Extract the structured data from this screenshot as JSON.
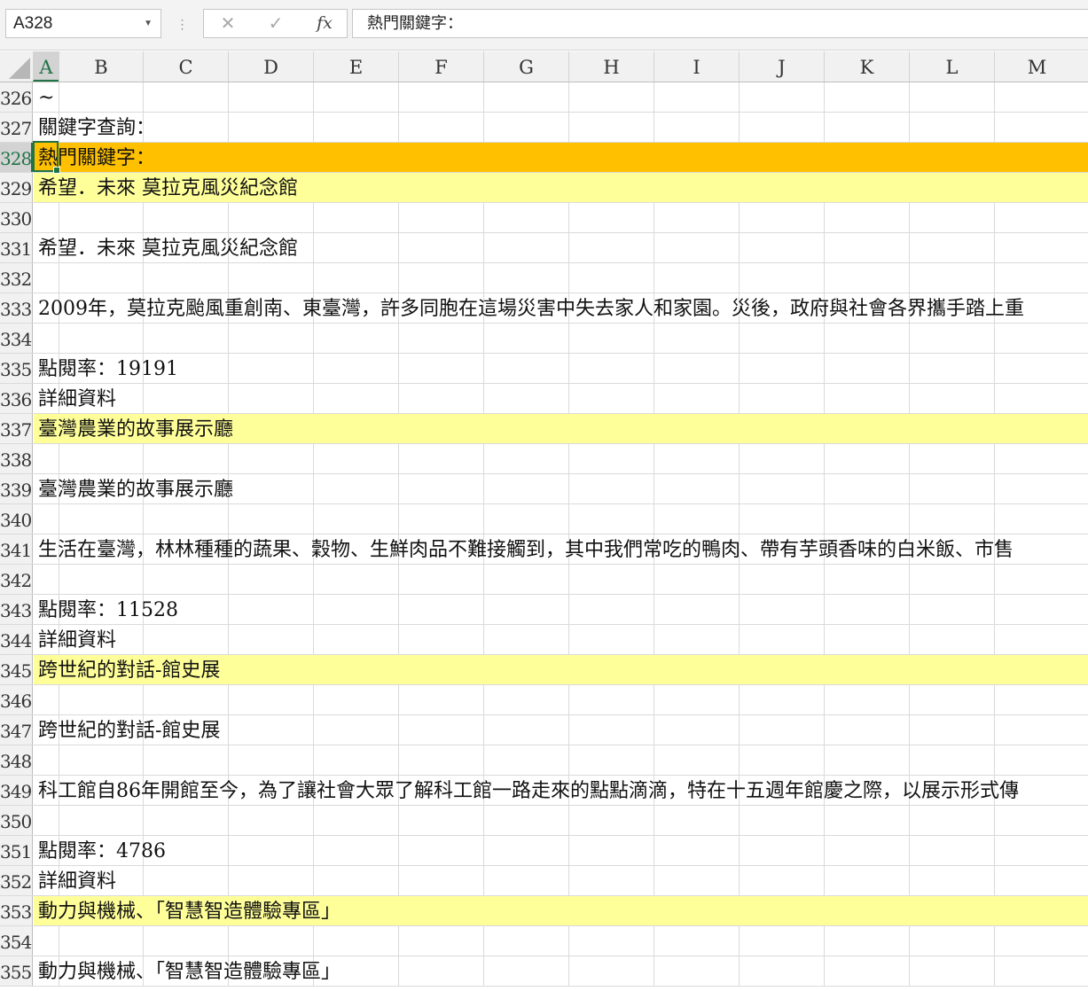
{
  "formula_bar": {
    "name_box": "A328",
    "cancel_icon": "✕",
    "enter_icon": "✓",
    "fx_label": "fx",
    "formula": "熱門關鍵字："
  },
  "columns": [
    "A",
    "B",
    "C",
    "D",
    "E",
    "F",
    "G",
    "H",
    "I",
    "J",
    "K",
    "L",
    "M"
  ],
  "active_column": "A",
  "active_row": "328",
  "colors": {
    "selection": "#217346",
    "orange_fill": "#ffc000",
    "yellow_fill": "#ffff99"
  },
  "rows": [
    {
      "num": "326",
      "text": "~",
      "fill": ""
    },
    {
      "num": "327",
      "text": "關鍵字查詢：",
      "fill": ""
    },
    {
      "num": "328",
      "text": "熱門關鍵字：",
      "fill": "orange"
    },
    {
      "num": "329",
      "text": "希望．未來 莫拉克風災紀念館",
      "fill": "yellow"
    },
    {
      "num": "330",
      "text": "",
      "fill": ""
    },
    {
      "num": "331",
      "text": "希望．未來 莫拉克風災紀念館",
      "fill": ""
    },
    {
      "num": "332",
      "text": "",
      "fill": ""
    },
    {
      "num": "333",
      "text": "2009年，莫拉克颱風重創南、東臺灣，許多同胞在這場災害中失去家人和家園。災後，政府與社會各界攜手踏上重",
      "fill": ""
    },
    {
      "num": "334",
      "text": "",
      "fill": ""
    },
    {
      "num": "335",
      "text": "點閱率：19191",
      "fill": ""
    },
    {
      "num": "336",
      "text": "詳細資料",
      "fill": ""
    },
    {
      "num": "337",
      "text": "臺灣農業的故事展示廳",
      "fill": "yellow"
    },
    {
      "num": "338",
      "text": "",
      "fill": ""
    },
    {
      "num": "339",
      "text": "臺灣農業的故事展示廳",
      "fill": ""
    },
    {
      "num": "340",
      "text": "",
      "fill": ""
    },
    {
      "num": "341",
      "text": "生活在臺灣，林林種種的蔬果、穀物、生鮮肉品不難接觸到，其中我們常吃的鴨肉、帶有芋頭香味的白米飯、市售",
      "fill": ""
    },
    {
      "num": "342",
      "text": "",
      "fill": ""
    },
    {
      "num": "343",
      "text": "點閱率：11528",
      "fill": ""
    },
    {
      "num": "344",
      "text": "詳細資料",
      "fill": ""
    },
    {
      "num": "345",
      "text": "跨世紀的對話-館史展",
      "fill": "yellow"
    },
    {
      "num": "346",
      "text": "",
      "fill": ""
    },
    {
      "num": "347",
      "text": "跨世紀的對話-館史展",
      "fill": ""
    },
    {
      "num": "348",
      "text": "",
      "fill": ""
    },
    {
      "num": "349",
      "text": "科工館自86年開館至今，為了讓社會大眾了解科工館一路走來的點點滴滴，特在十五週年館慶之際，以展示形式傳",
      "fill": ""
    },
    {
      "num": "350",
      "text": "",
      "fill": ""
    },
    {
      "num": "351",
      "text": "點閱率：4786",
      "fill": ""
    },
    {
      "num": "352",
      "text": "詳細資料",
      "fill": ""
    },
    {
      "num": "353",
      "text": "動力與機械、「智慧智造體驗專區」",
      "fill": "yellow"
    },
    {
      "num": "354",
      "text": "",
      "fill": ""
    },
    {
      "num": "355",
      "text": "動力與機械、「智慧智造體驗專區」",
      "fill": ""
    }
  ]
}
